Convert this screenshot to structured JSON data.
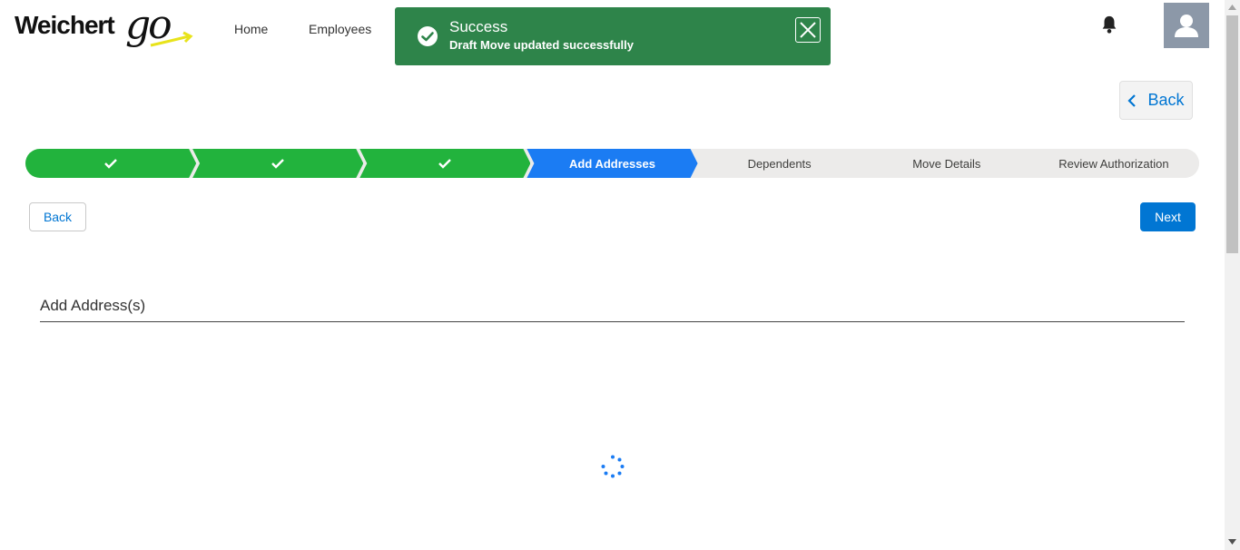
{
  "header": {
    "logo_text": "Weichert",
    "logo_accent": "go",
    "nav": [
      {
        "label": "Home"
      },
      {
        "label": "Employees"
      }
    ]
  },
  "toast": {
    "title": "Success",
    "message": "Draft Move updated successfully",
    "color": "#2e844a"
  },
  "top_back_label": "Back",
  "path": {
    "steps": [
      {
        "label": "",
        "state": "complete"
      },
      {
        "label": "",
        "state": "complete"
      },
      {
        "label": "",
        "state": "complete"
      },
      {
        "label": "Add Addresses",
        "state": "current"
      },
      {
        "label": "Dependents",
        "state": "incomplete"
      },
      {
        "label": "Move Details",
        "state": "incomplete"
      },
      {
        "label": "Review Authorization",
        "state": "incomplete"
      }
    ]
  },
  "actions": {
    "back_label": "Back",
    "next_label": "Next"
  },
  "section": {
    "title": "Add Address(s)"
  },
  "colors": {
    "accent": "#0176d3",
    "complete": "#22b33d",
    "current": "#1b7cf3"
  }
}
